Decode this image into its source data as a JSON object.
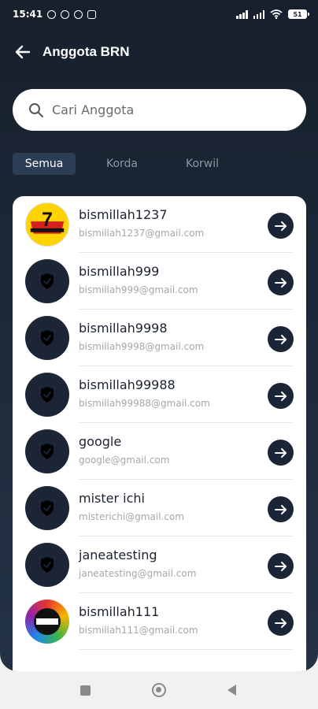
{
  "status_bar": {
    "time": "15:41",
    "battery": "51"
  },
  "header": {
    "title": "Anggota BRN"
  },
  "search": {
    "placeholder": "Cari Anggota"
  },
  "tabs": [
    {
      "label": "Semua",
      "active": true
    },
    {
      "label": "Korda",
      "active": false
    },
    {
      "label": "Korwil",
      "active": false
    }
  ],
  "members": [
    {
      "name": "bismillah1237",
      "email": "bismillah1237@gmail.com",
      "avatar": "logo-7"
    },
    {
      "name": "bismillah999",
      "email": "bismillah999@gmail.com",
      "avatar": "shield-icon"
    },
    {
      "name": "bismillah9998",
      "email": "bismillah9998@gmail.com",
      "avatar": "shield-icon"
    },
    {
      "name": "bismillah99988",
      "email": "bismillah99988@gmail.com",
      "avatar": "shield-icon"
    },
    {
      "name": "google",
      "email": "google@gmail.com",
      "avatar": "shield-icon"
    },
    {
      "name": "mister ichi",
      "email": "misterichi@gmail.com",
      "avatar": "shield-icon"
    },
    {
      "name": "janeatesting",
      "email": "janeatesting@gmail.com",
      "avatar": "shield-icon"
    },
    {
      "name": "bismillah111",
      "email": "bismillah111@gmail.com",
      "avatar": "anti-coding-club-logo"
    }
  ],
  "colors": {
    "header_bg": "#1c2838",
    "tab_active_bg": "#2c3d56",
    "avatar_bg": "#1b2536",
    "card_bg": "#ffffff"
  }
}
